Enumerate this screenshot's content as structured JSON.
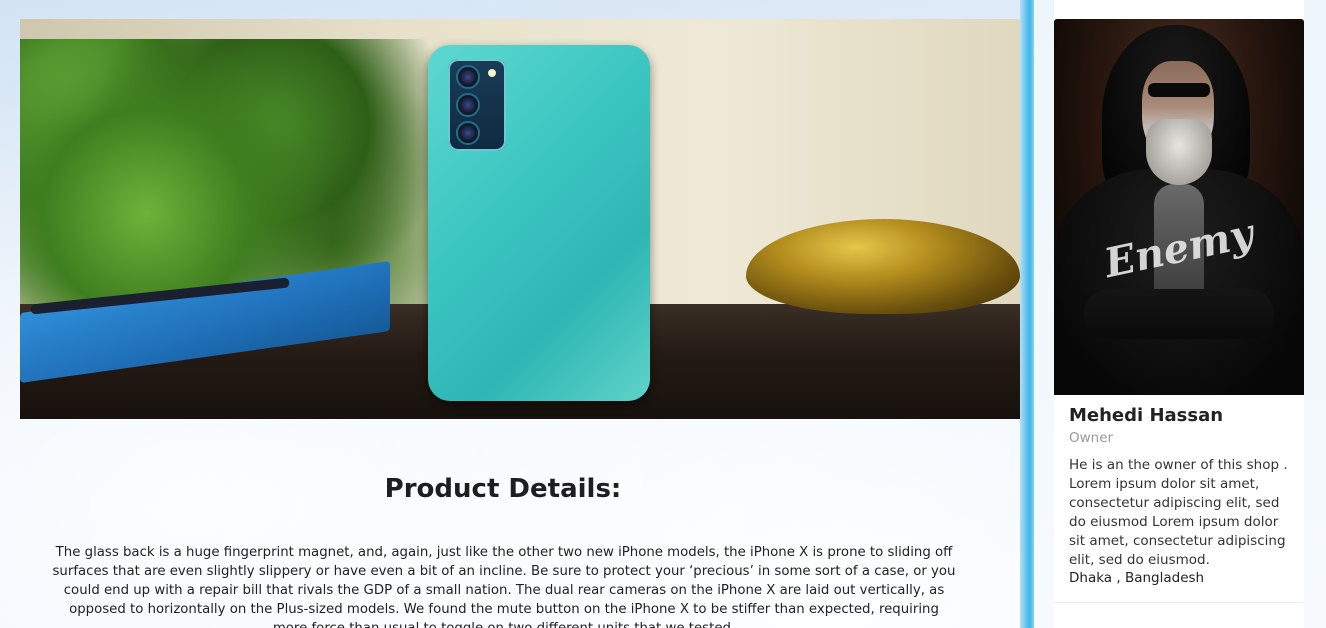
{
  "product": {
    "image_alt": "Teal smartphone on a wooden table",
    "details_title": "Product Details:",
    "details_text": "The glass back is a huge fingerprint magnet, and, again, just like the other two new iPhone models, the iPhone X is prone to sliding off surfaces that are even slightly slippery or have even a bit of an incline. Be sure to protect your ‘precious’ in some sort of a case, or you could end up with a repair bill that rivals the GDP of a small nation. The dual rear cameras on the iPhone X are laid out vertically, as opposed to horizontally on the Plus-sized models. We found the mute button on the iPhone X to be stiffer than expected, requiring more force than usual to toggle on two different units that we tested."
  },
  "owner": {
    "name": "Mehedi Hassan",
    "role": "Owner",
    "bio": "He is an the owner of this shop . Lorem ipsum dolor sit amet, consectetur adipiscing elit, sed do eiusmod Lorem ipsum dolor sit amet, consectetur adipiscing elit, sed do eiusmod.",
    "location": "Dhaka , Bangladesh",
    "shirt_logo": "Enemy"
  },
  "colors": {
    "divider": "#3fb6e8",
    "title": "#1e1e1e",
    "role": "#999999"
  }
}
